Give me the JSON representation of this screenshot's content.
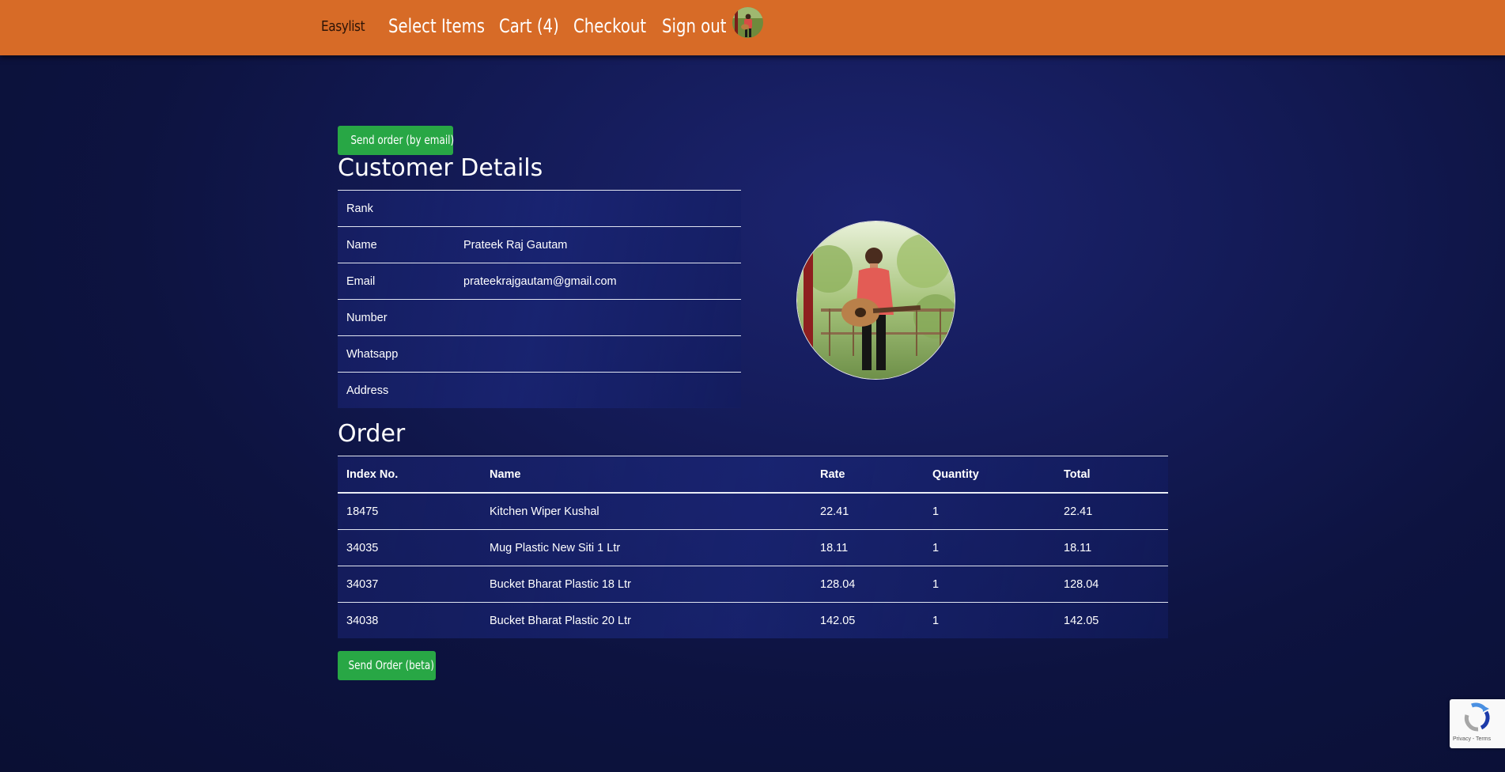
{
  "navbar": {
    "brand": "Easylist",
    "links": [
      "Select Items",
      "Cart (4)",
      "Checkout",
      "Sign out"
    ]
  },
  "buttons": {
    "send_email": "Send order (by email)",
    "send_beta": "Send Order (beta)"
  },
  "customer": {
    "title": "Customer Details",
    "rows": [
      {
        "label": "Rank",
        "value": ""
      },
      {
        "label": "Name",
        "value": "Prateek Raj Gautam"
      },
      {
        "label": "Email",
        "value": "prateekrajgautam@gmail.com"
      },
      {
        "label": "Number",
        "value": ""
      },
      {
        "label": "Whatsapp",
        "value": ""
      },
      {
        "label": "Address",
        "value": ""
      }
    ]
  },
  "order": {
    "title": "Order",
    "columns": [
      "Index No.",
      "Name",
      "Rate",
      "Quantity",
      "Total"
    ],
    "rows": [
      [
        "18475",
        "Kitchen Wiper Kushal",
        "22.41",
        "1",
        "22.41"
      ],
      [
        "34035",
        "Mug Plastic New Siti 1 Ltr",
        "18.11",
        "1",
        "18.11"
      ],
      [
        "34037",
        "Bucket Bharat Plastic 18 Ltr",
        "128.04",
        "1",
        "128.04"
      ],
      [
        "34038",
        "Bucket Bharat Plastic 20 Ltr",
        "142.05",
        "1",
        "142.05"
      ]
    ]
  },
  "recaptcha": {
    "terms": "Privacy - Terms"
  },
  "colors": {
    "navbar": "#d76b27",
    "button": "#28a745",
    "background": "#0d1340"
  }
}
